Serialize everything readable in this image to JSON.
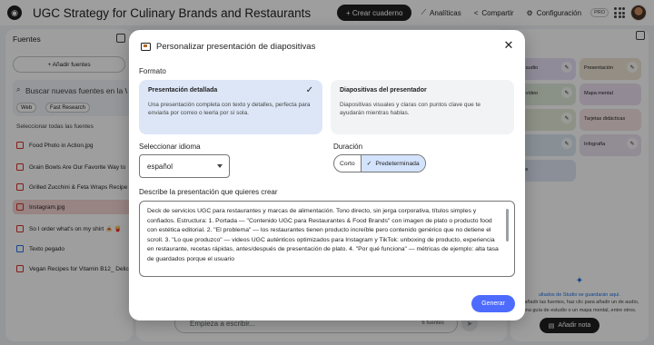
{
  "app": {
    "title": "UGC Strategy for Culinary Brands and Restaurants",
    "create_label": "+ Crear cuaderno",
    "analytics_label": "Analíticas",
    "share_label": "Compartir",
    "settings_label": "Configuración",
    "pro_label": "PRO"
  },
  "sources": {
    "heading": "Fuentes",
    "add_label": "+ Añadir fuentes",
    "search_placeholder": "Buscar nuevas fuentes en la Web",
    "chip_web": "Web",
    "chip_research": "Fast Research",
    "select_all": "Seleccionar todas las fuentes",
    "items": [
      {
        "label": "Food Photo in Action.jpg"
      },
      {
        "label": "Grain Bowls Are Our Favorite Way to"
      },
      {
        "label": "Grilled Zucchini & Feta Wraps Recipe"
      },
      {
        "label": "Instagram.jpg"
      },
      {
        "label": "So I order what's on my shirt 🍝 🍟"
      },
      {
        "label": "Texto pegado"
      },
      {
        "label": "Vegan Recipes for Vitamin B12_ Delic"
      }
    ]
  },
  "studio": {
    "tiles": [
      {
        "label": "de audio"
      },
      {
        "label": "Presentación"
      },
      {
        "label": "de vídeo"
      },
      {
        "label": "Mapa mental"
      },
      {
        "label": ""
      },
      {
        "label": "Tarjetas didácticas"
      },
      {
        "label": ""
      },
      {
        "label": "Infografía"
      },
      {
        "label": "atos"
      }
    ],
    "note_title": "ultados de Studio se guardarán aquí.",
    "note_body": "e añadir las fuentes, haz clic para añadir un de audio, una guía de estudio o un mapa mental, entre otros.",
    "add_note_label": "Añadir nota"
  },
  "chat": {
    "placeholder": "Empieza a escribir...",
    "source_count": "6 fuentes"
  },
  "dialog": {
    "title": "Personalizar presentación de diapositivas",
    "format_label": "Formato",
    "formats": [
      {
        "title": "Presentación detallada",
        "desc": "Una presentación completa con texto y detalles, perfecta para enviarla por correo o leerla por sí sola.",
        "selected": true
      },
      {
        "title": "Diapositivas del presentador",
        "desc": "Diapositivas visuales y claras con puntos clave que te ayudarán mientras hablas.",
        "selected": false
      }
    ],
    "language_label": "Seleccionar idioma",
    "language_value": "español",
    "duration_label": "Duración",
    "duration_short": "Corto",
    "duration_default": "Predeterminada",
    "prompt_label": "Describe la presentación que quieres crear",
    "prompt_text": "Deck de servicios UGC para restaurantes y marcas de alimentación. Tono directo, sin jerga corporativa, títulos simples y confiados. Estructura: 1. Portada — \"Contenido UGC para Restaurantes & Food Brands\" con imagen de plato o producto food con estética editorial. 2. \"El problema\" — los restaurantes tienen producto increíble pero contenido genérico que no detiene el scroll. 3. \"Lo que produzco\" — videos UGC auténticos optimizados para Instagram y TikTok: unboxing de producto, experiencia en restaurante, recetas rápidas, antes/después de presentación de plato. 4. \"Por qué funciona\" — métricas de ejemplo: alta tasa de guardados porque el usuario",
    "generate_label": "Generar"
  }
}
